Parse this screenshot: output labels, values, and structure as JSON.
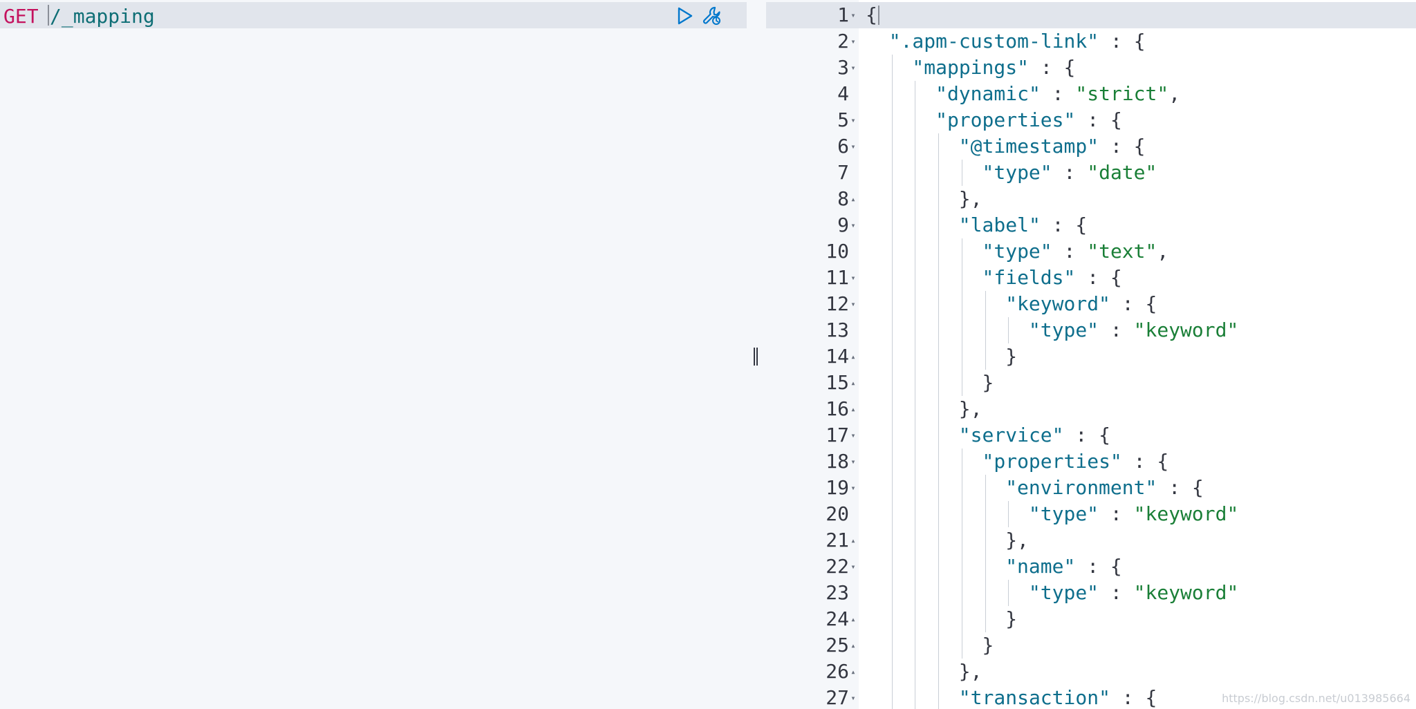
{
  "request": {
    "method": "GET",
    "path": "/_mapping",
    "run_icon": "play-icon",
    "settings_icon": "wrench-icon"
  },
  "response": {
    "lines": [
      {
        "n": "1",
        "fold": "down",
        "indent": 0,
        "parts": [
          [
            "p",
            "{"
          ]
        ]
      },
      {
        "n": "2",
        "fold": "down",
        "indent": 1,
        "parts": [
          [
            "k",
            "\".apm-custom-link\""
          ],
          [
            "p",
            " : {"
          ]
        ]
      },
      {
        "n": "3",
        "fold": "down",
        "indent": 2,
        "parts": [
          [
            "k",
            "\"mappings\""
          ],
          [
            "p",
            " : {"
          ]
        ]
      },
      {
        "n": "4",
        "fold": "",
        "indent": 3,
        "parts": [
          [
            "k",
            "\"dynamic\""
          ],
          [
            "p",
            " : "
          ],
          [
            "s",
            "\"strict\""
          ],
          [
            "p",
            ","
          ]
        ]
      },
      {
        "n": "5",
        "fold": "down",
        "indent": 3,
        "parts": [
          [
            "k",
            "\"properties\""
          ],
          [
            "p",
            " : {"
          ]
        ]
      },
      {
        "n": "6",
        "fold": "down",
        "indent": 4,
        "parts": [
          [
            "k",
            "\"@timestamp\""
          ],
          [
            "p",
            " : {"
          ]
        ]
      },
      {
        "n": "7",
        "fold": "",
        "indent": 5,
        "parts": [
          [
            "k",
            "\"type\""
          ],
          [
            "p",
            " : "
          ],
          [
            "s",
            "\"date\""
          ]
        ]
      },
      {
        "n": "8",
        "fold": "up",
        "indent": 4,
        "parts": [
          [
            "p",
            "},"
          ]
        ]
      },
      {
        "n": "9",
        "fold": "down",
        "indent": 4,
        "parts": [
          [
            "k",
            "\"label\""
          ],
          [
            "p",
            " : {"
          ]
        ]
      },
      {
        "n": "10",
        "fold": "",
        "indent": 5,
        "parts": [
          [
            "k",
            "\"type\""
          ],
          [
            "p",
            " : "
          ],
          [
            "s",
            "\"text\""
          ],
          [
            "p",
            ","
          ]
        ]
      },
      {
        "n": "11",
        "fold": "down",
        "indent": 5,
        "parts": [
          [
            "k",
            "\"fields\""
          ],
          [
            "p",
            " : {"
          ]
        ]
      },
      {
        "n": "12",
        "fold": "down",
        "indent": 6,
        "parts": [
          [
            "k",
            "\"keyword\""
          ],
          [
            "p",
            " : {"
          ]
        ]
      },
      {
        "n": "13",
        "fold": "",
        "indent": 7,
        "parts": [
          [
            "k",
            "\"type\""
          ],
          [
            "p",
            " : "
          ],
          [
            "s",
            "\"keyword\""
          ]
        ]
      },
      {
        "n": "14",
        "fold": "up",
        "indent": 6,
        "parts": [
          [
            "p",
            "}"
          ]
        ]
      },
      {
        "n": "15",
        "fold": "up",
        "indent": 5,
        "parts": [
          [
            "p",
            "}"
          ]
        ]
      },
      {
        "n": "16",
        "fold": "up",
        "indent": 4,
        "parts": [
          [
            "p",
            "},"
          ]
        ]
      },
      {
        "n": "17",
        "fold": "down",
        "indent": 4,
        "parts": [
          [
            "k",
            "\"service\""
          ],
          [
            "p",
            " : {"
          ]
        ]
      },
      {
        "n": "18",
        "fold": "down",
        "indent": 5,
        "parts": [
          [
            "k",
            "\"properties\""
          ],
          [
            "p",
            " : {"
          ]
        ]
      },
      {
        "n": "19",
        "fold": "down",
        "indent": 6,
        "parts": [
          [
            "k",
            "\"environment\""
          ],
          [
            "p",
            " : {"
          ]
        ]
      },
      {
        "n": "20",
        "fold": "",
        "indent": 7,
        "parts": [
          [
            "k",
            "\"type\""
          ],
          [
            "p",
            " : "
          ],
          [
            "s",
            "\"keyword\""
          ]
        ]
      },
      {
        "n": "21",
        "fold": "up",
        "indent": 6,
        "parts": [
          [
            "p",
            "},"
          ]
        ]
      },
      {
        "n": "22",
        "fold": "down",
        "indent": 6,
        "parts": [
          [
            "k",
            "\"name\""
          ],
          [
            "p",
            " : {"
          ]
        ]
      },
      {
        "n": "23",
        "fold": "",
        "indent": 7,
        "parts": [
          [
            "k",
            "\"type\""
          ],
          [
            "p",
            " : "
          ],
          [
            "s",
            "\"keyword\""
          ]
        ]
      },
      {
        "n": "24",
        "fold": "up",
        "indent": 6,
        "parts": [
          [
            "p",
            "}"
          ]
        ]
      },
      {
        "n": "25",
        "fold": "up",
        "indent": 5,
        "parts": [
          [
            "p",
            "}"
          ]
        ]
      },
      {
        "n": "26",
        "fold": "up",
        "indent": 4,
        "parts": [
          [
            "p",
            "},"
          ]
        ]
      },
      {
        "n": "27",
        "fold": "down",
        "indent": 4,
        "parts": [
          [
            "k",
            "\"transaction\""
          ],
          [
            "p",
            " : {"
          ]
        ]
      }
    ]
  },
  "watermark": "https://blog.csdn.net/u013985664",
  "colors": {
    "method": "#c4125e",
    "path": "#0e6e75",
    "key": "#0e6e8c",
    "string": "#1a7f37",
    "punct": "#343741",
    "active_line": "#e1e5ec"
  }
}
